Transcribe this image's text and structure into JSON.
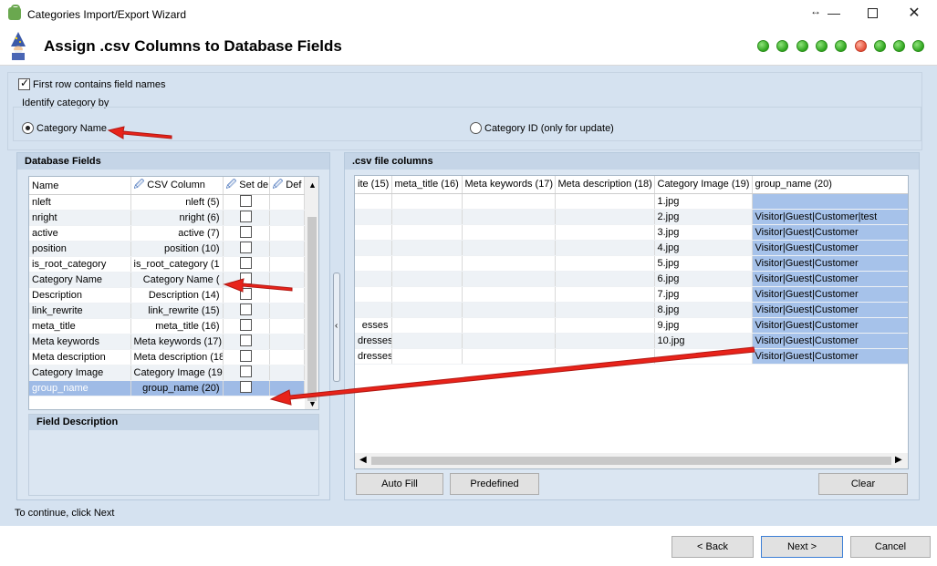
{
  "window": {
    "title": "Categories Import/Export Wizard"
  },
  "header": {
    "title": "Assign .csv Columns to Database Fields",
    "steps": [
      {
        "state": "done"
      },
      {
        "state": "done"
      },
      {
        "state": "done"
      },
      {
        "state": "done"
      },
      {
        "state": "done"
      },
      {
        "state": "active"
      },
      {
        "state": "done"
      },
      {
        "state": "done"
      },
      {
        "state": "done"
      }
    ]
  },
  "options": {
    "first_row_label": "First row contains field names",
    "identify_label": "Identify category by",
    "radio_name": "Category Name",
    "radio_id": "Category ID (only for update)"
  },
  "db_fields": {
    "title": "Database Fields",
    "columns": [
      "Name",
      "CSV Column",
      "Set de",
      "Def"
    ],
    "rows": [
      {
        "name": "nleft",
        "csv": "nleft (5)"
      },
      {
        "name": "nright",
        "csv": "nright (6)"
      },
      {
        "name": "active",
        "csv": "active (7)"
      },
      {
        "name": "position",
        "csv": "position (10)"
      },
      {
        "name": "is_root_category",
        "csv": "is_root_category (1"
      },
      {
        "name": "Category Name",
        "csv": "Category Name ("
      },
      {
        "name": "Description",
        "csv": "Description (14)"
      },
      {
        "name": "link_rewrite",
        "csv": "link_rewrite (15)"
      },
      {
        "name": "meta_title",
        "csv": "meta_title (16)"
      },
      {
        "name": "Meta keywords",
        "csv": "Meta keywords (17)"
      },
      {
        "name": "Meta description",
        "csv": "Meta description (18"
      },
      {
        "name": "Category Image",
        "csv": "Category Image (19"
      },
      {
        "name": "group_name",
        "csv": "group_name (20)"
      }
    ],
    "field_description_title": "Field Description"
  },
  "csv_columns": {
    "title": ".csv file columns",
    "columns": [
      "ite (15)",
      "meta_title (16)",
      "Meta keywords (17)",
      "Meta description (18)",
      "Category Image (19)",
      "group_name (20)"
    ],
    "rows": [
      {
        "c1": "",
        "image": "1.jpg",
        "group": ""
      },
      {
        "c1": "",
        "image": "2.jpg",
        "group": "Visitor|Guest|Customer|test"
      },
      {
        "c1": "",
        "image": "3.jpg",
        "group": "Visitor|Guest|Customer"
      },
      {
        "c1": "",
        "image": "4.jpg",
        "group": "Visitor|Guest|Customer"
      },
      {
        "c1": "",
        "image": "5.jpg",
        "group": "Visitor|Guest|Customer"
      },
      {
        "c1": "",
        "image": "6.jpg",
        "group": "Visitor|Guest|Customer"
      },
      {
        "c1": "",
        "image": "7.jpg",
        "group": "Visitor|Guest|Customer"
      },
      {
        "c1": "",
        "image": "8.jpg",
        "group": "Visitor|Guest|Customer"
      },
      {
        "c1": "esses",
        "image": "9.jpg",
        "group": "Visitor|Guest|Customer"
      },
      {
        "c1": "dresses",
        "image": "10.jpg",
        "group": "Visitor|Guest|Customer"
      },
      {
        "c1": "dresses",
        "image": "",
        "group": "Visitor|Guest|Customer"
      }
    ],
    "auto_fill": "Auto Fill",
    "predefined": "Predefined",
    "clear": "Clear"
  },
  "status": "To continue, click Next",
  "footer": {
    "back": "< Back",
    "next": "Next >",
    "cancel": "Cancel"
  },
  "colors": {
    "arrow": "#e8231a",
    "selected_cell": "#a6c2ea",
    "active_step": "#e5503a",
    "done_step": "#2fa51e"
  }
}
